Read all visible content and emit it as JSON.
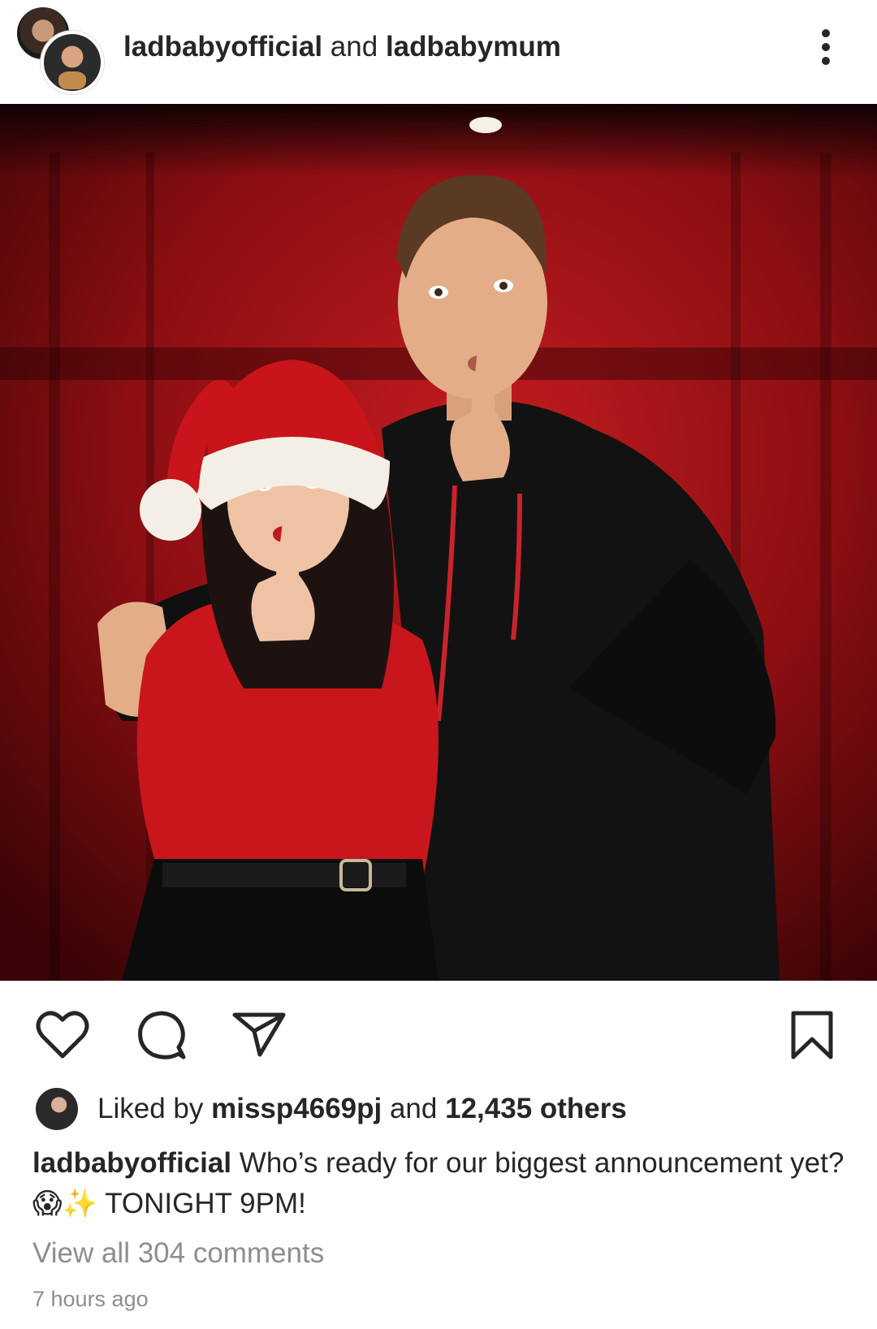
{
  "post": {
    "author_primary": "ladbabyofficial",
    "conjunction": "and",
    "author_collab": "ladbabymum",
    "photo_alt": "Couple in front of red curtain making a shush gesture, woman wearing Santa hat",
    "likes": {
      "prefix": "Liked by",
      "liker": "missp4669pj",
      "middle": "and",
      "count_text": "12,435 others"
    },
    "caption": {
      "user": "ladbabyofficial",
      "text_part1": "Who’s ready for our biggest announcement yet?",
      "emoji1": "😱",
      "emoji2": "✨",
      "text_part2": "TONIGHT 9PM!"
    },
    "view_comments": "View all 304 comments",
    "timestamp": "7 hours ago"
  },
  "icons": {
    "more": "more-options-icon",
    "like": "heart-icon",
    "comment": "comment-icon",
    "share": "send-icon",
    "save": "bookmark-icon",
    "tag": "person-tag-icon"
  }
}
